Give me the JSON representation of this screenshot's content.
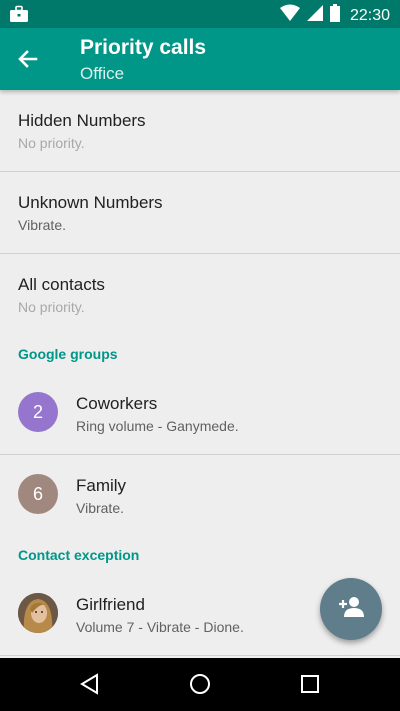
{
  "status_bar": {
    "time": "22:30",
    "icons": [
      "briefcase-icon",
      "wifi-icon",
      "signal-icon",
      "battery-icon"
    ]
  },
  "app_bar": {
    "title": "Priority calls",
    "subtitle": "Office",
    "back_icon": "arrow-back-icon"
  },
  "rows": [
    {
      "primary": "Hidden Numbers",
      "secondary": "No priority."
    },
    {
      "primary": "Unknown Numbers",
      "secondary": "Vibrate."
    },
    {
      "primary": "All contacts",
      "secondary": "No priority."
    }
  ],
  "google_groups": {
    "header": "Google groups",
    "items": [
      {
        "initial": "2",
        "name": "Coworkers",
        "detail": "Ring volume - Ganymede.",
        "color": "#9575cd"
      },
      {
        "initial": "6",
        "name": "Family",
        "detail": "Vibrate.",
        "color": "#a1887f"
      }
    ]
  },
  "contact_exception": {
    "header": "Contact exception",
    "items": [
      {
        "name": "Girlfriend",
        "detail": "Volume 7 - Vibrate - Dione.",
        "avatar": "contact-photo"
      }
    ]
  },
  "fab": {
    "icon": "person-add-icon"
  },
  "nav": {
    "icons": [
      "back-triangle-icon",
      "home-circle-icon",
      "recents-square-icon"
    ]
  },
  "colors": {
    "status_bar": "#00796b",
    "app_bar": "#009688",
    "accent": "#009688",
    "fab": "#607d8b"
  }
}
